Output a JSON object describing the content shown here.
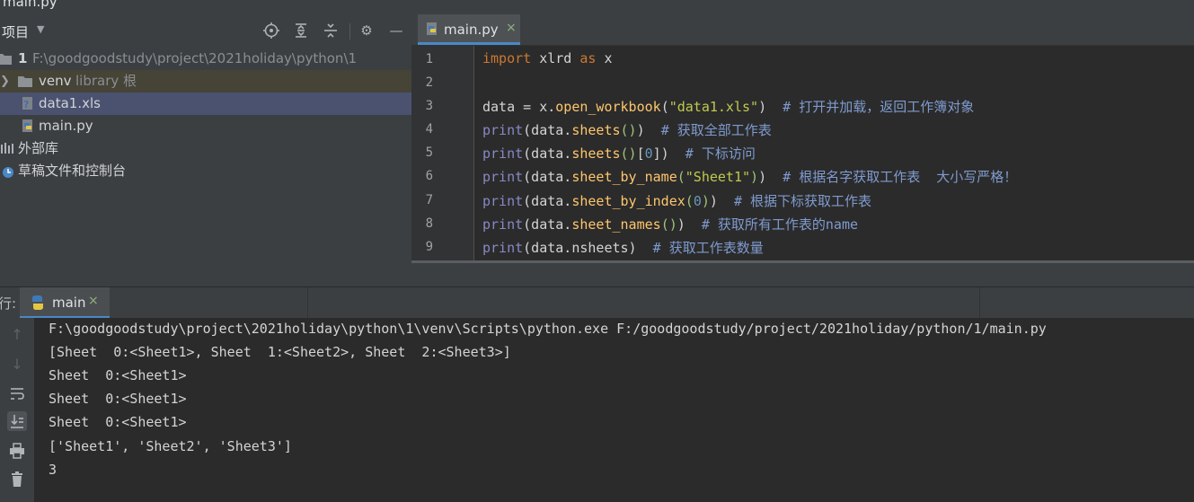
{
  "window": {
    "title": "main.py"
  },
  "project_panel": {
    "title": "项目",
    "tree": [
      {
        "name": "1",
        "path": "F:\\goodgoodstudy\\project\\2021holiday\\python\\1"
      },
      {
        "name": "venv",
        "tag": "library 根"
      },
      {
        "name": "data1.xls"
      },
      {
        "name": "main.py"
      },
      {
        "name": "外部库"
      },
      {
        "name": "草稿文件和控制台"
      }
    ]
  },
  "editor": {
    "tab": {
      "label": "main.py",
      "close": "×"
    },
    "line_numbers": [
      "1",
      "2",
      "3",
      "4",
      "5",
      "6",
      "7",
      "8",
      "9"
    ],
    "comments": {
      "l3": "# 打开并加载，返回工作簿对象",
      "l4": "# 获取全部工作表",
      "l5": "# 下标访问",
      "l6": "# 根据名字获取工作表  大小写严格！",
      "l7": "# 根据下标获取工作表",
      "l8": "# 获取所有工作表的name",
      "l9": "# 获取工作表数量"
    }
  },
  "run_panel": {
    "label": "行:",
    "tab": {
      "label": "main",
      "close": "×"
    },
    "output": [
      "F:\\goodgoodstudy\\project\\2021holiday\\python\\1\\venv\\Scripts\\python.exe F:/goodgoodstudy/project/2021holiday/python/1/main.py",
      "[Sheet  0:<Sheet1>, Sheet  1:<Sheet2>, Sheet  2:<Sheet3>]",
      "Sheet  0:<Sheet1>",
      "Sheet  0:<Sheet1>",
      "Sheet  0:<Sheet1>",
      "['Sheet1', 'Sheet2', 'Sheet3']",
      "3"
    ]
  },
  "colors": {
    "accent": "#4a88c7",
    "selection": "#4b5270",
    "keyword": "#cc7832",
    "builtin": "#8888c6",
    "string": "#c0c94f"
  }
}
